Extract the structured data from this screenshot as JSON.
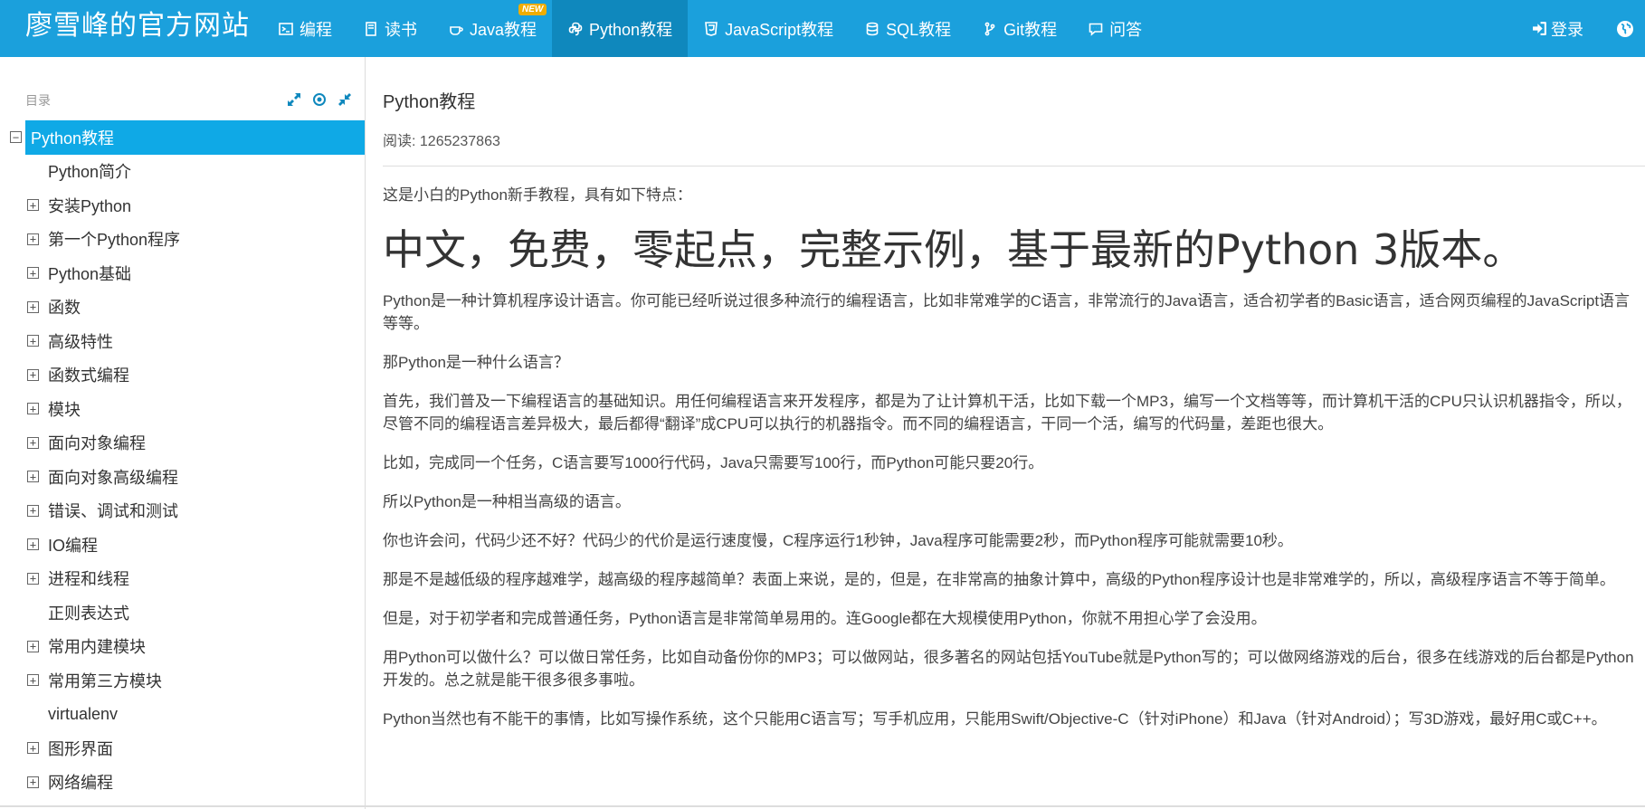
{
  "brand": "廖雪峰的官方网站",
  "nav": {
    "items": [
      {
        "label": "编程",
        "icon": "terminal-icon"
      },
      {
        "label": "读书",
        "icon": "book-icon"
      },
      {
        "label": "Java教程",
        "icon": "coffee-icon",
        "badge": "NEW"
      },
      {
        "label": "Python教程",
        "icon": "python-icon",
        "active": true
      },
      {
        "label": "JavaScript教程",
        "icon": "html5-icon"
      },
      {
        "label": "SQL教程",
        "icon": "database-icon"
      },
      {
        "label": "Git教程",
        "icon": "git-branch-icon"
      },
      {
        "label": "问答",
        "icon": "comment-icon"
      }
    ],
    "login": "登录"
  },
  "sidebar": {
    "heading": "目录",
    "items": [
      {
        "label": "Python教程",
        "toggle": "minus",
        "level": 0,
        "active": true
      },
      {
        "label": "Python简介",
        "toggle": "",
        "level": 1
      },
      {
        "label": "安装Python",
        "toggle": "plus",
        "level": 1
      },
      {
        "label": "第一个Python程序",
        "toggle": "plus",
        "level": 1
      },
      {
        "label": "Python基础",
        "toggle": "plus",
        "level": 1
      },
      {
        "label": "函数",
        "toggle": "plus",
        "level": 1
      },
      {
        "label": "高级特性",
        "toggle": "plus",
        "level": 1
      },
      {
        "label": "函数式编程",
        "toggle": "plus",
        "level": 1
      },
      {
        "label": "模块",
        "toggle": "plus",
        "level": 1
      },
      {
        "label": "面向对象编程",
        "toggle": "plus",
        "level": 1
      },
      {
        "label": "面向对象高级编程",
        "toggle": "plus",
        "level": 1
      },
      {
        "label": "错误、调试和测试",
        "toggle": "plus",
        "level": 1
      },
      {
        "label": "IO编程",
        "toggle": "plus",
        "level": 1
      },
      {
        "label": "进程和线程",
        "toggle": "plus",
        "level": 1
      },
      {
        "label": "正则表达式",
        "toggle": "",
        "level": 1
      },
      {
        "label": "常用内建模块",
        "toggle": "plus",
        "level": 1
      },
      {
        "label": "常用第三方模块",
        "toggle": "plus",
        "level": 1
      },
      {
        "label": "virtualenv",
        "toggle": "",
        "level": 1
      },
      {
        "label": "图形界面",
        "toggle": "plus",
        "level": 1
      },
      {
        "label": "网络编程",
        "toggle": "plus",
        "level": 1
      }
    ]
  },
  "article": {
    "title": "Python教程",
    "reads": "阅读: 1265237863",
    "intro": "这是小白的Python新手教程，具有如下特点：",
    "headline": "中文，免费，零起点，完整示例，基于最新的Python 3版本。",
    "paragraphs": [
      "Python是一种计算机程序设计语言。你可能已经听说过很多种流行的编程语言，比如非常难学的C语言，非常流行的Java语言，适合初学者的Basic语言，适合网页编程的JavaScript语言等等。",
      "那Python是一种什么语言？",
      "首先，我们普及一下编程语言的基础知识。用任何编程语言来开发程序，都是为了让计算机干活，比如下载一个MP3，编写一个文档等等，而计算机干活的CPU只认识机器指令，所以，尽管不同的编程语言差异极大，最后都得“翻译”成CPU可以执行的机器指令。而不同的编程语言，干同一个活，编写的代码量，差距也很大。",
      "比如，完成同一个任务，C语言要写1000行代码，Java只需要写100行，而Python可能只要20行。",
      "所以Python是一种相当高级的语言。",
      "你也许会问，代码少还不好？代码少的代价是运行速度慢，C程序运行1秒钟，Java程序可能需要2秒，而Python程序可能就需要10秒。",
      "那是不是越低级的程序越难学，越高级的程序越简单？表面上来说，是的，但是，在非常高的抽象计算中，高级的Python程序设计也是非常难学的，所以，高级程序语言不等于简单。",
      "但是，对于初学者和完成普通任务，Python语言是非常简单易用的。连Google都在大规模使用Python，你就不用担心学了会没用。",
      "用Python可以做什么？可以做日常任务，比如自动备份你的MP3；可以做网站，很多著名的网站包括YouTube就是Python写的；可以做网络游戏的后台，很多在线游戏的后台都是Python开发的。总之就是能干很多很多事啦。",
      "Python当然也有不能干的事情，比如写操作系统，这个只能用C语言写；写手机应用，只能用Swift/Objective-C（针对iPhone）和Java（针对Android）；写3D游戏，最好用C或C++。"
    ]
  },
  "colors": {
    "header_bg": "#1ba0dc",
    "active_nav_bg": "#0f88bd",
    "active_toc_bg": "#0fa9e6",
    "badge": "#f0ad00",
    "tool_icon": "#0f88bd"
  }
}
